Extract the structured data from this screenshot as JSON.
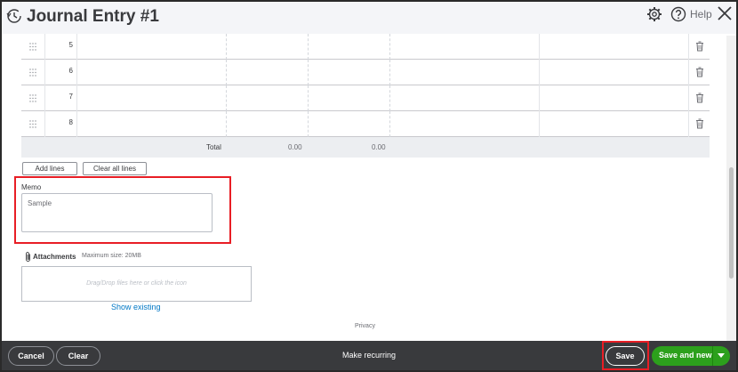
{
  "header": {
    "title": "Journal Entry #1",
    "help_label": "Help"
  },
  "table": {
    "rows": [
      {
        "line": "5"
      },
      {
        "line": "6"
      },
      {
        "line": "7"
      },
      {
        "line": "8"
      }
    ],
    "total_label": "Total",
    "total_debit": "0.00",
    "total_credit": "0.00",
    "add_lines_label": "Add lines",
    "clear_all_lines_label": "Clear all lines"
  },
  "memo": {
    "label": "Memo",
    "value": "Sample"
  },
  "attachments": {
    "label": "Attachments",
    "max_size": "Maximum size: 20MB",
    "dropzone_text": "Drag/Drop files here or click the icon",
    "show_existing": "Show existing"
  },
  "privacy": "Privacy",
  "footer": {
    "cancel_label": "Cancel",
    "clear_label": "Clear",
    "make_recurring_label": "Make recurring",
    "save_label": "Save",
    "save_new_label": "Save and new"
  },
  "colors": {
    "primary_green": "#2ca01c",
    "link_blue": "#0077c5",
    "highlight_red": "#e81e25",
    "footer_bg": "#393a3d"
  },
  "icons": [
    "history-icon",
    "gear-icon",
    "help-icon",
    "close-icon",
    "drag-handle-icon",
    "trash-icon",
    "paperclip-icon",
    "chevron-down-icon"
  ]
}
